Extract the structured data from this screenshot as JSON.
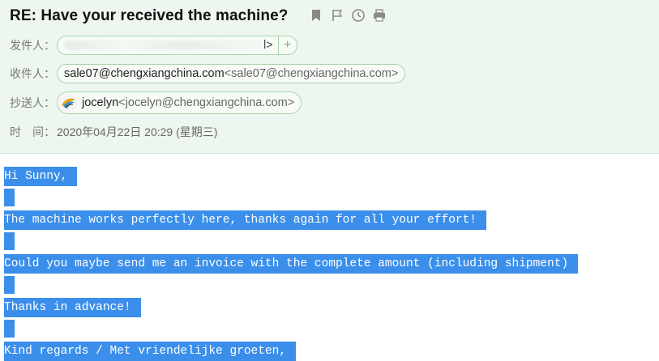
{
  "subject": "RE: Have your received the machine?",
  "toolbar": {
    "icons": [
      "bookmark-icon",
      "flag-icon",
      "clock-icon",
      "print-icon"
    ]
  },
  "from": {
    "label": "发件人：",
    "address_suffix": "l>",
    "plus": "+"
  },
  "to": {
    "label": "收件人：",
    "name": "sale07@chengxiangchina.com",
    "email": "<sale07@chengxiangchina.com>"
  },
  "cc": {
    "label": "抄送人：",
    "name": "jocelyn",
    "email": "<jocelyn@chengxiangchina.com>"
  },
  "time": {
    "label": "时　间：",
    "value": "2020年04月22日 20:29 (星期三)"
  },
  "body_lines": [
    "Hi Sunny,",
    "The machine works perfectly here, thanks again for all your effort!",
    "Could you maybe send me an invoice with the complete amount (including shipment)",
    "Thanks in advance!",
    "Kind regards / Met vriendelijke groeten,"
  ],
  "colors": {
    "header_bg": "#eef7ef",
    "chip_border": "#a9d3aa",
    "selection": "#3b8fea",
    "icon_gray": "#8a8a8a"
  }
}
